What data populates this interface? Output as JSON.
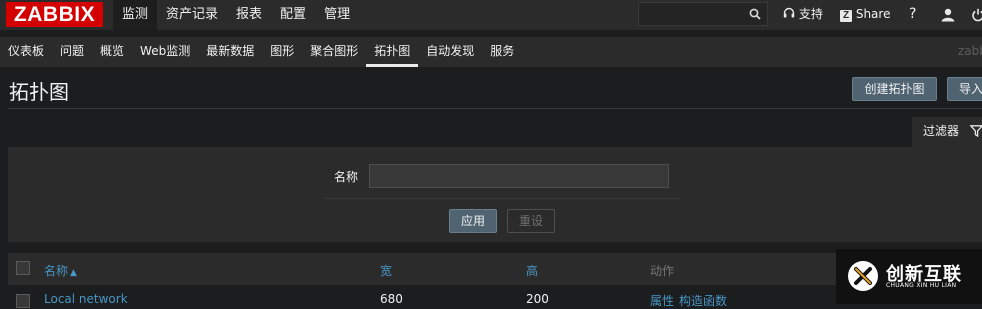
{
  "logo": "ZABBIX",
  "main_menu": [
    {
      "label": "监测",
      "active": true
    },
    {
      "label": "资产记录",
      "active": false
    },
    {
      "label": "报表",
      "active": false
    },
    {
      "label": "配置",
      "active": false
    },
    {
      "label": "管理",
      "active": false
    }
  ],
  "top_right": {
    "search_placeholder": "",
    "support": "支持",
    "share": "Share",
    "share_badge": "Z",
    "help": "?"
  },
  "sub_menu": [
    {
      "label": "仪表板",
      "active": false
    },
    {
      "label": "问题",
      "active": false
    },
    {
      "label": "概览",
      "active": false
    },
    {
      "label": "Web监测",
      "active": false
    },
    {
      "label": "最新数据",
      "active": false
    },
    {
      "label": "图形",
      "active": false
    },
    {
      "label": "聚合图形",
      "active": false
    },
    {
      "label": "拓扑图",
      "active": true
    },
    {
      "label": "自动发现",
      "active": false
    },
    {
      "label": "服务",
      "active": false
    }
  ],
  "sub_right": "zabb",
  "page": {
    "title": "拓扑图",
    "create_button": "创建拓扑图",
    "import_button": "导入"
  },
  "filter": {
    "tab_label": "过滤器",
    "name_label": "名称",
    "name_value": "",
    "apply_button": "应用",
    "reset_button": "重设"
  },
  "table": {
    "columns": [
      "名称",
      "宽",
      "高",
      "动作"
    ],
    "sort_indicator": "▲",
    "rows": [
      {
        "name": "Local network",
        "width": "680",
        "height": "200",
        "actions": [
          "属性",
          "构造函数"
        ]
      }
    ]
  },
  "watermark": {
    "name": "创新互联",
    "subtitle": "CHUANG XIN HU LIAN"
  },
  "colors": {
    "brand_red": "#d40000",
    "link_blue": "#4796c4",
    "button_blue": "#4f6371",
    "header_bg": "#2b2b2b",
    "page_bg": "#1c1d1f"
  }
}
